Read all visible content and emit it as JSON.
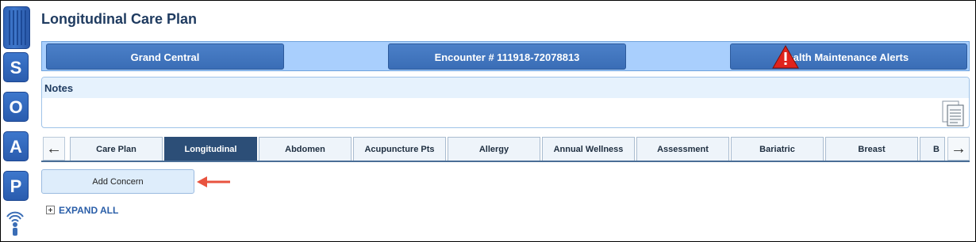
{
  "page": {
    "title": "Longitudinal Care Plan"
  },
  "soap": {
    "letters": [
      "S",
      "O",
      "A",
      "P"
    ]
  },
  "header": {
    "location_label": "Grand Central",
    "encounter_label": "Encounter # 111918-72078813",
    "alerts_label": "Health Maintenance Alerts"
  },
  "notes": {
    "label": "Notes"
  },
  "tabs": {
    "prev_symbol": "←",
    "next_symbol": "→",
    "items": [
      {
        "label": "Care Plan"
      },
      {
        "label": "Longitudinal"
      },
      {
        "label": "Abdomen"
      },
      {
        "label": "Acupuncture Pts"
      },
      {
        "label": "Allergy"
      },
      {
        "label": "Annual Wellness"
      },
      {
        "label": "Assessment"
      },
      {
        "label": "Bariatric"
      },
      {
        "label": "Breast"
      },
      {
        "label": "B"
      }
    ],
    "active_index": 1
  },
  "actions": {
    "add_concern_label": "Add Concern",
    "expand_all_label": "EXPAND ALL"
  },
  "colors": {
    "accent": "#2c4e77",
    "header_band": "#a9cffd",
    "alert_red": "#e0231c",
    "pointer_arrow": "#e8533f"
  }
}
